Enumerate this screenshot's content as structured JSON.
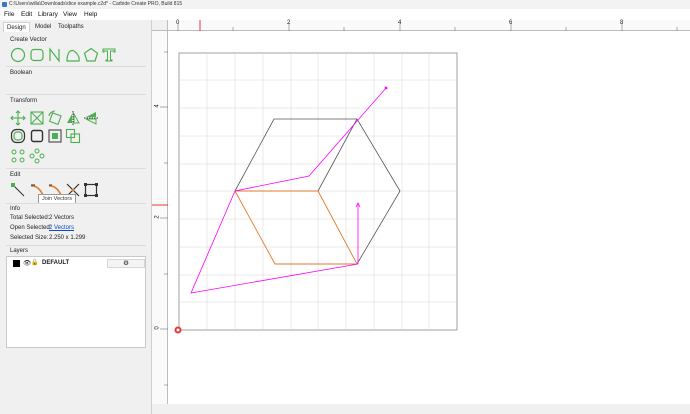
{
  "window": {
    "title": "C:\\Users\\willa\\Downloads\\dice example.c2d* - Carbide Create PRO, Build 815"
  },
  "menu": {
    "items": [
      "File",
      "Edit",
      "Library",
      "View",
      "Help"
    ]
  },
  "tabs": [
    "Design",
    "Model",
    "Toolpaths"
  ],
  "sections": {
    "create_vector": "Create Vector",
    "boolean": "Boolean",
    "transform": "Transform",
    "edit": "Edit",
    "info": "Info",
    "layers": "Layers"
  },
  "tooltip": "Join Vectors",
  "info": {
    "total_selected_label": "Total Selected:",
    "total_selected_value": "2 Vectors",
    "open_selected_label": "Open Selected:",
    "open_selected_value": "2 Vectors",
    "selected_size_label": "Selected Size:",
    "selected_size_value": "2.250 x 1.299"
  },
  "layers": [
    {
      "name": "DEFAULT",
      "color": "#000000"
    }
  ],
  "ruler": {
    "top_labels": [
      "0",
      "2",
      "4",
      "6",
      "8"
    ],
    "left_labels": [
      "4",
      "2",
      "0"
    ]
  },
  "icons": {
    "create_vector": [
      "circle-icon",
      "rounded-rectangle-icon",
      "polyline-icon",
      "curve-icon",
      "polygon-icon",
      "text-icon"
    ],
    "transform_row1": [
      "move-icon",
      "scale-icon",
      "rotate-icon",
      "mirror-horizontal-icon",
      "mirror-vertical-icon"
    ],
    "transform_row2": [
      "offset-icon",
      "fillet-icon",
      "align-icon",
      "weld-icon"
    ],
    "transform_row3": [
      "array-icon",
      "circular-array-icon"
    ],
    "edit": [
      "node-edit-icon",
      "trim-icon",
      "extend-icon",
      "join-vectors-icon",
      "bounding-box-icon"
    ]
  },
  "colors": {
    "accent_green": "#4caf50",
    "selected_vector": "#ff00ff",
    "orange_vector": "#e07a2a",
    "origin_red": "#e53935"
  }
}
